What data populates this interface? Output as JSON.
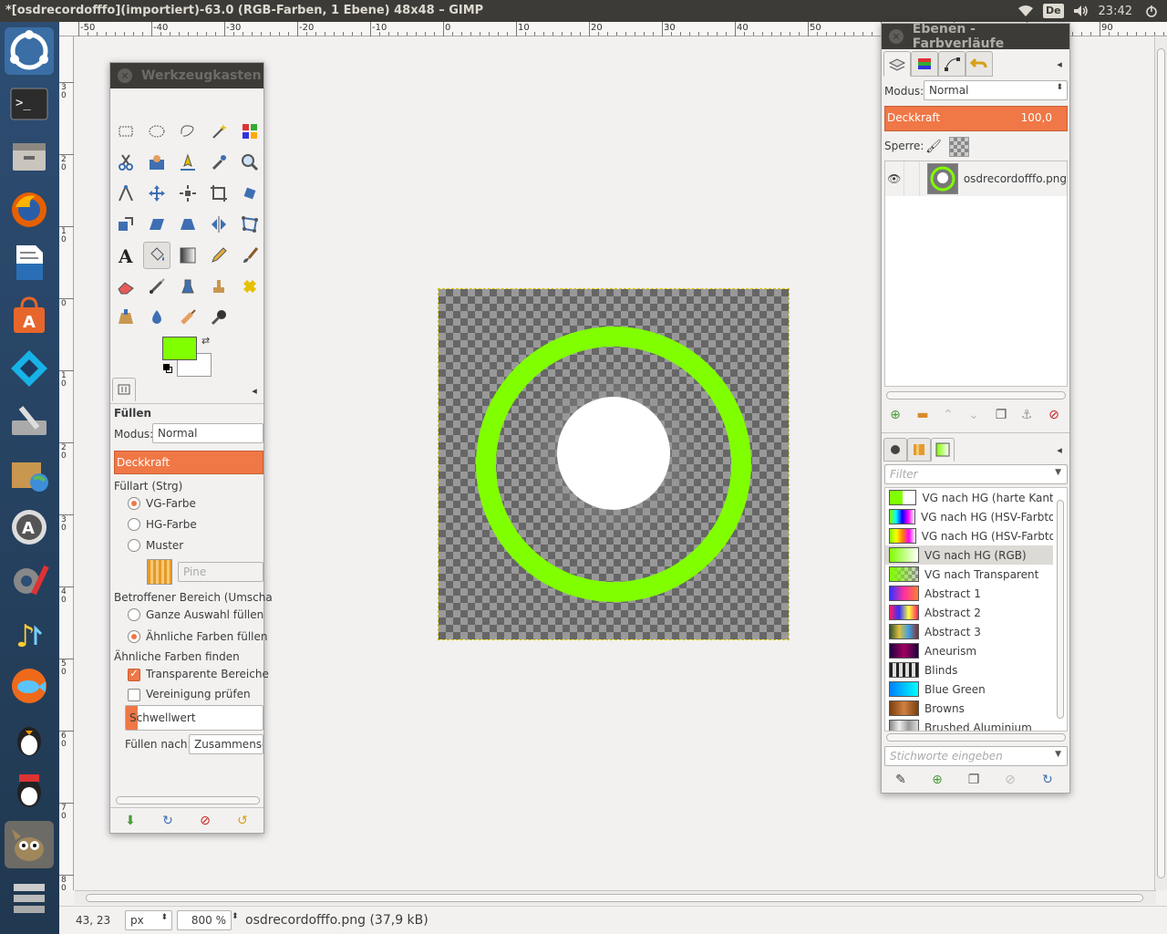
{
  "window_title": "*[osdrecordofffo](importiert)-63.0 (RGB-Farben, 1 Ebene) 48x48 – GIMP",
  "tray": {
    "keyboard_layout": "De",
    "clock": "23:42",
    "icons": [
      "wifi-icon",
      "keyboard-layout",
      "volume-icon"
    ]
  },
  "launcher": [
    "ubuntu-dash",
    "terminal",
    "file-manager",
    "firefox",
    "libreoffice-writer",
    "software-center",
    "kodi",
    "system-tool",
    "archive-manager",
    "software-updater",
    "system-settings",
    "music-player",
    "fish-app",
    "tux-game",
    "penguin-app",
    "gimp",
    "workspace-switcher"
  ],
  "ruler": {
    "top_labels": [
      "-50",
      "-40",
      "-30",
      "-20",
      "-10",
      "0",
      "10",
      "20",
      "30",
      "40",
      "50",
      "60",
      "70",
      "80",
      "90"
    ],
    "left_labels": [
      "30",
      "20",
      "10",
      "0",
      "10",
      "20",
      "30",
      "40",
      "50",
      "60",
      "70",
      "80"
    ]
  },
  "toolbox": {
    "title": "Werkzeugkasten",
    "tools": [
      "rect-select",
      "ellipse-select",
      "free-select",
      "fuzzy-select",
      "color-select",
      "scissors-select",
      "foreground-select",
      "paths",
      "color-picker",
      "zoom",
      "measure",
      "move",
      "align",
      "crop",
      "rotate",
      "scale",
      "shear",
      "perspective",
      "flip",
      "cage-transform",
      "text",
      "bucket-fill",
      "blend",
      "pencil",
      "paintbrush",
      "eraser",
      "airbrush",
      "ink",
      "clone",
      "heal",
      "perspective-clone",
      "blur",
      "smudge",
      "dodge-burn"
    ],
    "fg_color": "#80ff00",
    "bg_color": "#ffffff",
    "options": {
      "title": "Füllen",
      "modus_label": "Modus:",
      "modus_value": "Normal",
      "deckkraft_label": "Deckkraft",
      "fillart_label": "Füllart  (Strg)",
      "fill_vg": "VG-Farbe",
      "fill_hg": "HG-Farbe",
      "fill_muster": "Muster",
      "pattern_name": "Pine",
      "bereich_label": "Betroffener Bereich (Umscha",
      "ganze_auswahl": "Ganze Auswahl füllen",
      "aehnliche_farben": "Ähnliche Farben füllen",
      "finden_label": "Ähnliche Farben finden",
      "transparente": "Transparente Bereiche",
      "vereinigung": "Vereinigung prüfen",
      "schwellwert": "Schwellwert",
      "fuellen_nach_label": "Füllen nach:",
      "fuellen_nach_value": "Zusammenset"
    }
  },
  "layers_dock": {
    "title": "Ebenen - Farbverläufe",
    "modus_label": "Modus:",
    "modus_value": "Normal",
    "deckkraft_label": "Deckkraft",
    "deckkraft_value": "100,0",
    "sperre_label": "Sperre:",
    "layers": [
      {
        "name": "osdrecordofffo.png",
        "visible": true
      }
    ]
  },
  "gradients": {
    "filter_placeholder": "Filter",
    "tags_placeholder": "Stichworte eingeben",
    "items": [
      {
        "name": "VG nach HG (harte Kante)",
        "selected": false
      },
      {
        "name": "VG nach HG (HSV-Farbton g",
        "selected": false
      },
      {
        "name": "VG nach HG (HSV-Farbton i",
        "selected": false
      },
      {
        "name": "VG nach HG (RGB)",
        "selected": true
      },
      {
        "name": "VG nach Transparent",
        "selected": false
      },
      {
        "name": "Abstract 1",
        "selected": false
      },
      {
        "name": "Abstract 2",
        "selected": false
      },
      {
        "name": "Abstract 3",
        "selected": false
      },
      {
        "name": "Aneurism",
        "selected": false
      },
      {
        "name": "Blinds",
        "selected": false
      },
      {
        "name": "Blue Green",
        "selected": false
      },
      {
        "name": "Browns",
        "selected": false
      },
      {
        "name": "Brushed Aluminium",
        "selected": false
      }
    ]
  },
  "status": {
    "coords": "43, 23",
    "unit": "px",
    "zoom": "800 %",
    "file_info": "osdrecordofffo.png (37,9 kB)"
  },
  "colors": {
    "accent": "#f07746",
    "ring": "#80ff00",
    "panel_title_bg": "#3c3b37"
  }
}
